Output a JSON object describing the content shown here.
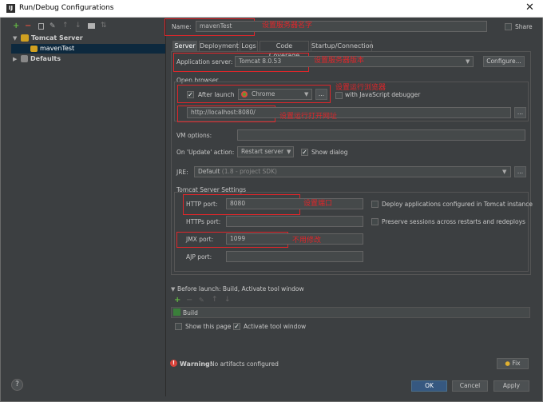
{
  "window": {
    "title": "Run/Debug Configurations",
    "icon_text": "IJ",
    "close": "✕"
  },
  "toolbar": {
    "add": "+",
    "remove": "−"
  },
  "tree": {
    "tomcat_label": "Tomcat Server",
    "config_label": "mavenTest",
    "defaults_label": "Defaults"
  },
  "name_row": {
    "label": "Name:",
    "value": "mavenTest",
    "share_label": "Share"
  },
  "tabs": [
    {
      "label": "Server"
    },
    {
      "label": "Deployment"
    },
    {
      "label": "Logs"
    },
    {
      "label": "Code Coverage"
    },
    {
      "label": "Startup/Connection"
    }
  ],
  "server": {
    "app_server_label": "Application server:",
    "app_server_value": "Tomcat 8.0.53",
    "configure_label": "Configure...",
    "open_browser_label": "Open browser",
    "after_launch_label": "After launch",
    "browser_value": "Chrome",
    "browser_more": "...",
    "js_debugger_label": "with JavaScript debugger",
    "url_value": "http://localhost:8080/",
    "url_more": "...",
    "vm_options_label": "VM options:",
    "update_action_label": "On 'Update' action:",
    "update_action_value": "Restart server",
    "show_dialog_label": "Show dialog",
    "jre_label": "JRE:",
    "jre_value": "Default",
    "jre_hint": "(1.8 - project SDK)",
    "jre_more": "...",
    "tomcat_settings_label": "Tomcat Server Settings",
    "http_port_label": "HTTP port:",
    "http_port_value": "8080",
    "https_port_label": "HTTPs port:",
    "jmx_port_label": "JMX port:",
    "jmx_port_value": "1099",
    "ajp_port_label": "AJP port:",
    "deploy_label": "Deploy applications configured in Tomcat instance",
    "preserve_label": "Preserve sessions across restarts and redeploys"
  },
  "before_launch": {
    "label": "Before launch: Build, Activate tool window",
    "build_item": "Build",
    "show_page_label": "Show this page",
    "activate_label": "Activate tool window"
  },
  "warning": {
    "title": "Warning:",
    "text": "No artifacts configured",
    "fix_label": "Fix"
  },
  "footer": {
    "help": "?",
    "ok": "OK",
    "cancel": "Cancel",
    "apply": "Apply"
  },
  "annotations": {
    "name": "设置服务器名字",
    "server_version": "设置服务器版本",
    "browser": "设置运行浏览器",
    "url": "设置运行打开网址",
    "port": "设置端口",
    "jmx": "不用修改"
  },
  "colors": {
    "annotation_red": "#e0262a",
    "ok_blue": "#365880",
    "selection": "#0d293e",
    "chrome_green": "#5a9e2f"
  }
}
